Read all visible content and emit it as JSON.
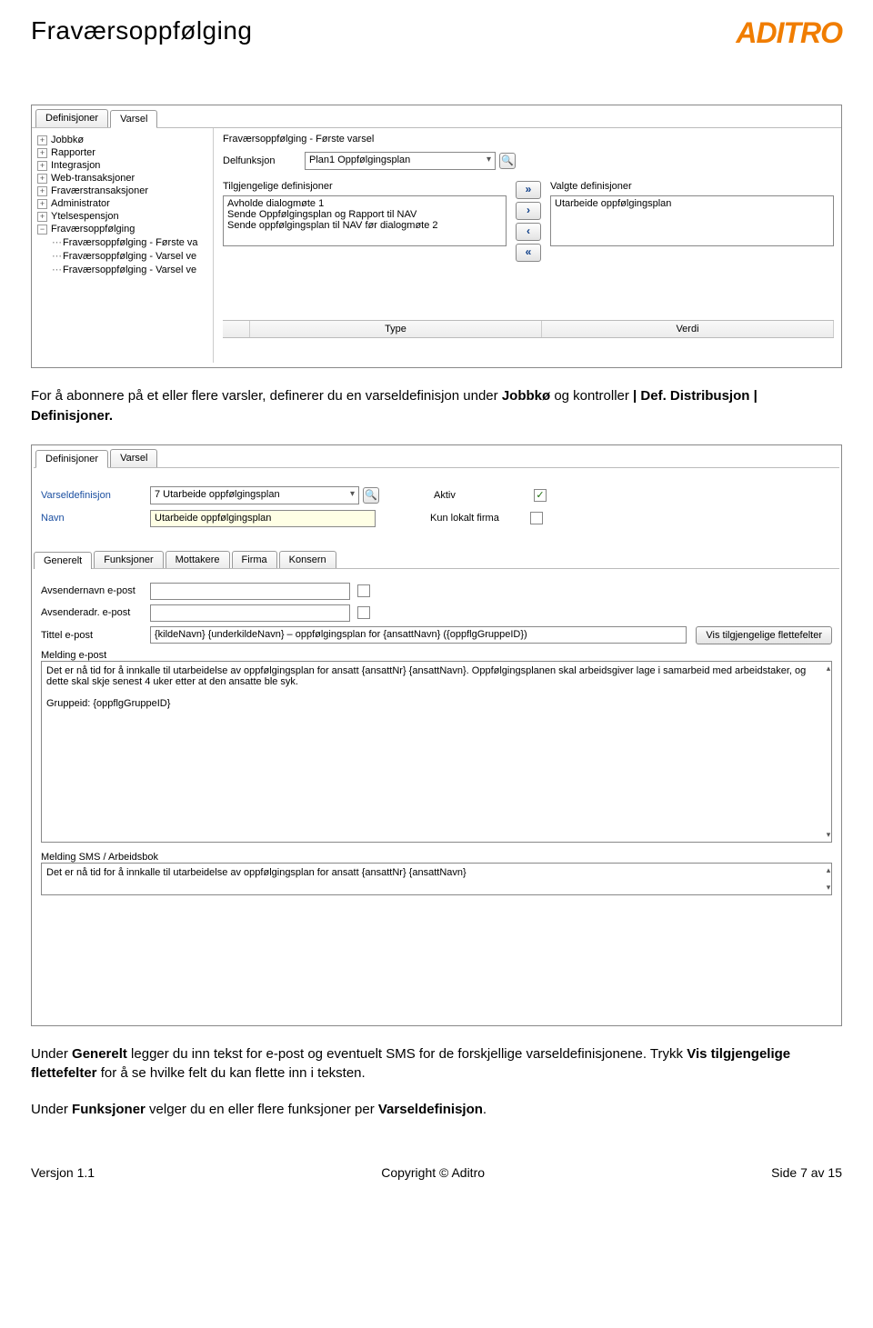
{
  "header": {
    "title": "Fraværsoppfølging",
    "logo": "ADITRO"
  },
  "panel1": {
    "tabs": [
      "Definisjoner",
      "Varsel"
    ],
    "activeTab": 1,
    "tree": {
      "roots": [
        {
          "label": "Jobbkø",
          "expand": "+"
        },
        {
          "label": "Rapporter",
          "expand": "+"
        },
        {
          "label": "Integrasjon",
          "expand": "+"
        },
        {
          "label": "Web-transaksjoner",
          "expand": "+"
        },
        {
          "label": "Fraværstransaksjoner",
          "expand": "+"
        },
        {
          "label": "Administrator",
          "expand": "+"
        },
        {
          "label": "Ytelsespensjon",
          "expand": "+"
        }
      ],
      "lastRoot": {
        "label": "Fraværsoppfølging",
        "expand": "−"
      },
      "children": [
        "Fraværsoppfølging - Første va",
        "Fraværsoppfølging - Varsel ve",
        "Fraværsoppfølging - Varsel ve"
      ]
    },
    "rightTitle": "Fraværsoppfølging - Første varsel",
    "delfunksjonLabel": "Delfunksjon",
    "delfunksjonValue": "Plan1 Oppfølgingsplan",
    "availLabel": "Tilgjengelige definisjoner",
    "availItems": [
      "Avholde dialogmøte 1",
      "Sende Oppfølgingsplan og Rapport til NAV",
      "Sende oppfølgingsplan til NAV før dialogmøte 2"
    ],
    "selLabel": "Valgte definisjoner",
    "selItems": [
      "Utarbeide oppfølgingsplan"
    ],
    "gridCols": [
      "Type",
      "Verdi"
    ]
  },
  "text1": "For å abonnere på et eller flere varsler, definerer du en varseldefinisjon under <b>Jobbkø</b> og kontroller <b>| Def. Distribusjon | Definisjoner.</b>",
  "panel2": {
    "topTabs": [
      "Definisjoner",
      "Varsel"
    ],
    "topActive": 0,
    "header": {
      "vdLabel": "Varseldefinisjon",
      "vdValue": "7 Utarbeide oppfølgingsplan",
      "navnLabel": "Navn",
      "navnValue": "Utarbeide oppfølgingsplan",
      "aktivLabel": "Aktiv",
      "aktivChecked": true,
      "lokalLabel": "Kun lokalt firma",
      "lokalChecked": false
    },
    "subTabs": [
      "Generelt",
      "Funksjoner",
      "Mottakere",
      "Firma",
      "Konsern"
    ],
    "subActive": 0,
    "gen": {
      "avsNavnLabel": "Avsendernavn e-post",
      "avsAdrLabel": "Avsenderadr. e-post",
      "tittelLabel": "Tittel e-post",
      "tittelValue": "{kildeNavn} {underkildeNavn} – oppfølgingsplan for {ansattNavn} ({oppflgGruppeID})",
      "fletteBtn": "Vis tilgjengelige flettefelter",
      "meldingEpostLabel": "Melding e-post",
      "meldingEpost": "Det er nå tid for å innkalle til utarbeidelse av oppfølgingsplan for ansatt {ansattNr} {ansattNavn}. Oppfølgingsplanen skal arbeidsgiver lage i samarbeid med arbeidstaker, og dette skal skje senest 4 uker etter at den ansatte ble syk.\n\nGruppeid: {oppflgGruppeID}",
      "meldingSmsLabel": "Melding SMS / Arbeidsbok",
      "meldingSms": "Det er nå tid for å innkalle til utarbeidelse av oppfølgingsplan for ansatt {ansattNr} {ansattNavn}"
    }
  },
  "text2": "Under <b>Generelt</b> legger du inn tekst for e-post og eventuelt SMS for de forskjellige varseldefinisjonene. Trykk <b>Vis tilgjengelige flettefelter</b> for å se hvilke felt du kan flette inn i teksten.",
  "text3": "Under <b>Funksjoner</b> velger du en eller flere funksjoner per <b>Varseldefinisjon</b>.",
  "footer": {
    "left": "Versjon 1.1",
    "center": "Copyright © Aditro",
    "right": "Side 7 av 15"
  }
}
